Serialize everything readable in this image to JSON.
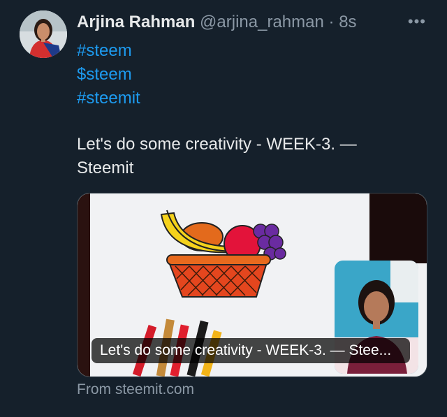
{
  "tweet": {
    "display_name": "Arjina Rahman",
    "handle": "@arjina_rahman",
    "separator": "·",
    "time": "8s",
    "more_label": "•••",
    "hashtags": [
      "#steem",
      "$steem",
      "#steemit"
    ],
    "text": "Let's do some creativity - WEEK-3. — Steemit"
  },
  "card": {
    "caption": "Let's do some creativity - WEEK-3. — Stee...",
    "source": "From steemit.com"
  },
  "colors": {
    "background": "#15202b",
    "link": "#1d9bf0",
    "secondary_text": "#8b98a5",
    "primary_text": "#e7e9ea"
  }
}
